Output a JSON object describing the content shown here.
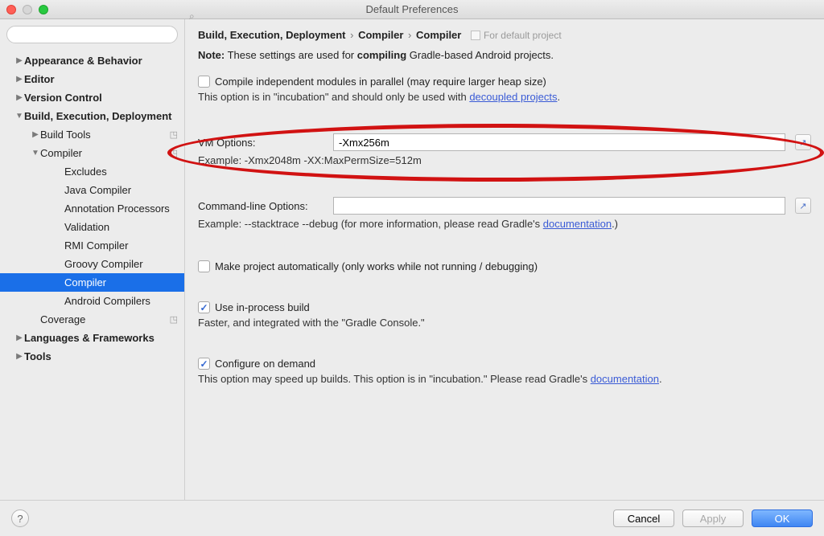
{
  "window": {
    "title": "Default Preferences"
  },
  "search": {
    "placeholder": ""
  },
  "sidebar": {
    "items": [
      {
        "label": "Appearance & Behavior",
        "indent": 0,
        "arrow": "right",
        "bold": true
      },
      {
        "label": "Editor",
        "indent": 0,
        "arrow": "right",
        "bold": true
      },
      {
        "label": "Version Control",
        "indent": 0,
        "arrow": "right",
        "bold": true
      },
      {
        "label": "Build, Execution, Deployment",
        "indent": 0,
        "arrow": "down",
        "bold": true
      },
      {
        "label": "Build Tools",
        "indent": 1,
        "arrow": "right",
        "badge": true
      },
      {
        "label": "Compiler",
        "indent": 1,
        "arrow": "down",
        "badge": true
      },
      {
        "label": "Excludes",
        "indent": 3
      },
      {
        "label": "Java Compiler",
        "indent": 3
      },
      {
        "label": "Annotation Processors",
        "indent": 3
      },
      {
        "label": "Validation",
        "indent": 3
      },
      {
        "label": "RMI Compiler",
        "indent": 3
      },
      {
        "label": "Groovy Compiler",
        "indent": 3
      },
      {
        "label": "Compiler",
        "indent": 3,
        "selected": true
      },
      {
        "label": "Android Compilers",
        "indent": 3
      },
      {
        "label": "Coverage",
        "indent": 1,
        "badge": true
      },
      {
        "label": "Languages & Frameworks",
        "indent": 0,
        "arrow": "right",
        "bold": true
      },
      {
        "label": "Tools",
        "indent": 0,
        "arrow": "right",
        "bold": true
      }
    ]
  },
  "breadcrumb": {
    "part1": "Build, Execution, Deployment",
    "part2": "Compiler",
    "part3": "Compiler",
    "suffix": "For default project"
  },
  "note": {
    "prefix": "Note:",
    "mid1": " These settings are used for ",
    "strong": "compiling",
    "mid2": " Gradle-based Android projects."
  },
  "parallel": {
    "checkbox_label": "Compile independent modules in parallel (may require larger heap size)",
    "sub_prefix": "This option is in \"incubation\" and should only be used with ",
    "link": "decoupled projects",
    "sub_suffix": "."
  },
  "vm": {
    "label": "VM Options:",
    "value": "-Xmx256m",
    "example": "Example: -Xmx2048m -XX:MaxPermSize=512m"
  },
  "cmdline": {
    "label": "Command-line Options:",
    "value": "",
    "example_prefix": "Example: --stacktrace --debug (for more information, please read Gradle's ",
    "link": "documentation",
    "example_suffix": ".)"
  },
  "auto": {
    "label": "Make project automatically (only works while not running / debugging)"
  },
  "inprocess": {
    "label": "Use in-process build",
    "sub": "Faster, and integrated with the \"Gradle Console.\""
  },
  "ondemand": {
    "label": "Configure on demand",
    "sub_prefix": "This option may speed up builds. This option is in \"incubation.\" Please read Gradle's ",
    "link": "documentation",
    "sub_suffix": "."
  },
  "buttons": {
    "cancel": "Cancel",
    "apply": "Apply",
    "ok": "OK"
  }
}
